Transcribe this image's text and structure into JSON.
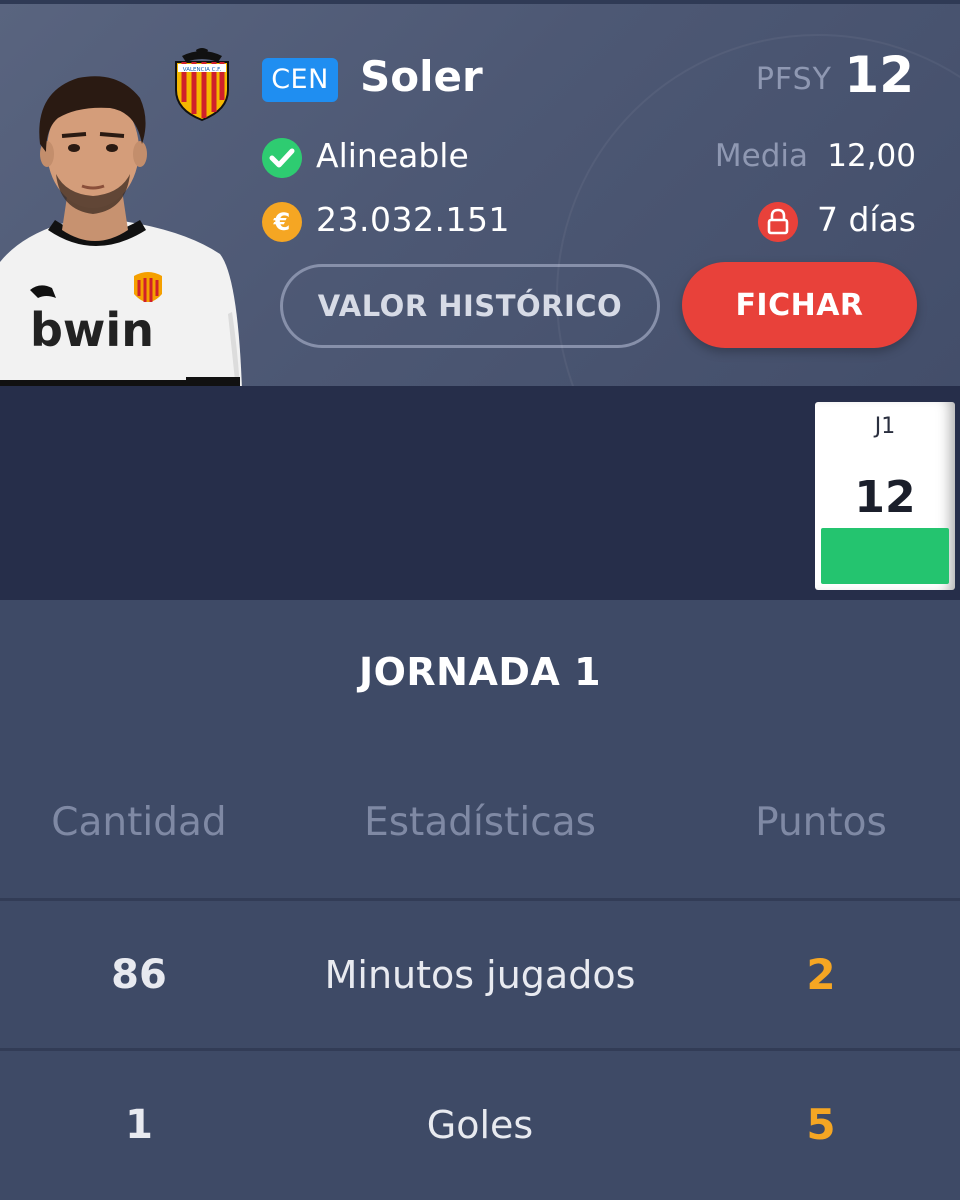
{
  "player": {
    "position_badge": "CEN",
    "name": "Soler",
    "club": "Valencia C.F.",
    "club_badge_text": "VALENCIA C.F.",
    "shirt_sponsor": "bwin",
    "status": "Alineable",
    "value": "23.032.151",
    "pfsy_label": "PFSY",
    "pfsy_points": "12",
    "media_label": "Media",
    "media_value": "12,00",
    "lock_text": "7 días"
  },
  "buttons": {
    "historic": "VALOR HISTÓRICO",
    "sign": "FICHAR"
  },
  "matchday": {
    "label": "J1",
    "points": "12",
    "bar_color": "#24c46f"
  },
  "stats": {
    "title": "JORNADA 1",
    "headers": [
      "Cantidad",
      "Estadísticas",
      "Puntos"
    ],
    "rows": [
      {
        "quantity": "86",
        "stat": "Minutos jugados",
        "points": "2"
      },
      {
        "quantity": "1",
        "stat": "Goles",
        "points": "5"
      }
    ]
  },
  "colors": {
    "accent_red": "#e8413a",
    "position_blue": "#1f8ef1",
    "points_orange": "#f5a623",
    "status_green": "#2ecc71"
  }
}
